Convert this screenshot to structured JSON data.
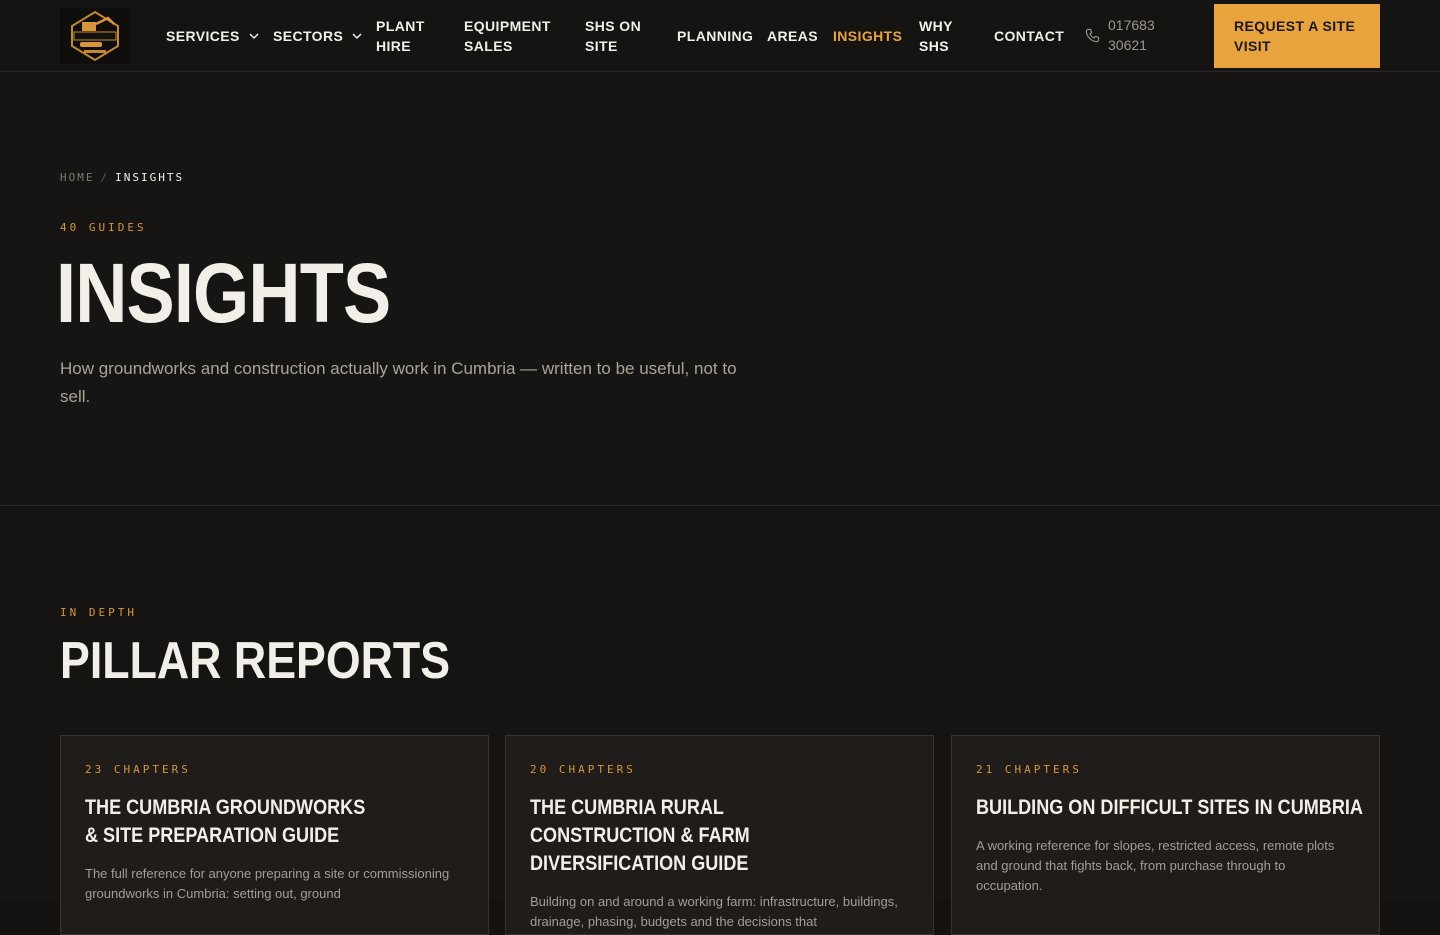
{
  "header": {
    "nav": [
      {
        "label": "SERVICES",
        "has_dropdown": true
      },
      {
        "label": "SECTORS",
        "has_dropdown": true
      },
      {
        "label": "PLANT HIRE",
        "has_dropdown": false
      },
      {
        "label": "EQUIPMENT SALES",
        "has_dropdown": false
      },
      {
        "label": "SHS ON SITE",
        "has_dropdown": false
      },
      {
        "label": "PLANNING",
        "has_dropdown": false
      },
      {
        "label": "AREAS",
        "has_dropdown": false
      },
      {
        "label": "INSIGHTS",
        "has_dropdown": false,
        "active": true
      },
      {
        "label": "WHY SHS",
        "has_dropdown": false
      },
      {
        "label": "CONTACT",
        "has_dropdown": false
      }
    ],
    "phone": "017683 30621",
    "cta_label": "REQUEST A SITE VISIT"
  },
  "hero": {
    "breadcrumb_home": "HOME",
    "breadcrumb_sep": "/",
    "breadcrumb_current": "INSIGHTS",
    "eyebrow": "40 GUIDES",
    "title": "INSIGHTS",
    "subtitle": "How groundworks and construction actually work in Cumbria — written to be useful, not to sell."
  },
  "pillars": {
    "eyebrow": "IN DEPTH",
    "title": "PILLAR REPORTS",
    "cards": [
      {
        "chapters": "23 CHAPTERS",
        "title": "THE CUMBRIA GROUNDWORKS & SITE PREPARATION GUIDE",
        "description": "The full reference for anyone preparing a site or commissioning groundworks in Cumbria: setting out, ground"
      },
      {
        "chapters": "20 CHAPTERS",
        "title": "THE CUMBRIA RURAL CONSTRUCTION & FARM DIVERSIFICATION GUIDE",
        "description": "Building on and around a working farm: infrastructure, buildings, drainage, phasing, budgets and the decisions that"
      },
      {
        "chapters": "21 CHAPTERS",
        "title": "BUILDING ON DIFFICULT SITES IN CUMBRIA",
        "description": "A working reference for slopes, restricted access, remote plots and ground that fights back, from purchase through to occupation."
      }
    ]
  },
  "colors": {
    "accent": "#e8a33c",
    "background": "#141210",
    "card": "#1f1c19"
  },
  "icons": {
    "logo": "excavator-logo",
    "dropdown": "chevron-down-icon",
    "phone": "phone-icon"
  }
}
